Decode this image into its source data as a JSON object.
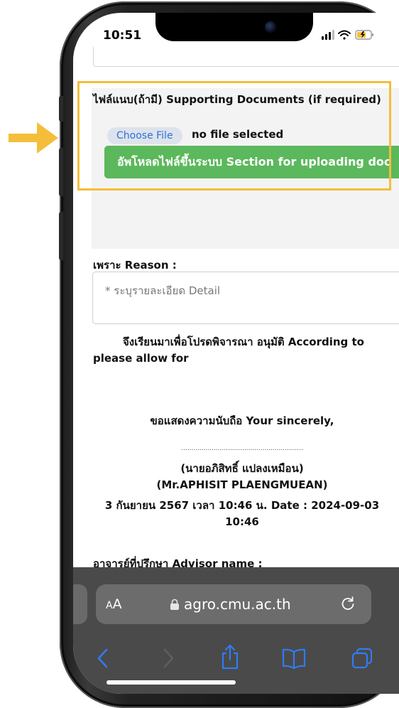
{
  "status_bar": {
    "time": "10:51"
  },
  "form": {
    "attachment_label": "ไฟล์แนบ(ถ้ามี) Supporting Documents (if required)",
    "choose_file_label": "Choose File",
    "no_file_text": "no file selected",
    "upload_button_label": "อัพโหลดไฟล์ขึ้นระบบ Section for uploading doc",
    "reason_label": "เพราะ Reason :",
    "reason_placeholder": "* ระบุรายละเอียด Detail",
    "request_text_line1": "จึงเรียนมาเพื่อโปรดพิจารณา อนุมัติ According to",
    "request_text_line2": "please allow for",
    "sincerely_text": "ขอแสดงความนับถือ Your sincerely,",
    "signature_dots": "............................................................",
    "signer_name_th": "(นายอภิสิทธิ์ แปลงเหมือน)",
    "signer_name_en": "(Mr.APHISIT  PLAENGMUEAN)",
    "signed_date": "3 กันยายน 2567 เวลา 10:46 น. Date : 2024-09-03",
    "signed_time": "10:46",
    "advisor_label": "อาจารย์ที่ปรึกษา Advisor name :"
  },
  "browser": {
    "text_size_label_big": "A",
    "text_size_label_small": "A",
    "url": "agro.cmu.ac.th",
    "icons": {
      "lock": "lock-icon",
      "reload": "reload-icon",
      "back": "back-icon",
      "forward": "forward-icon",
      "share": "share-icon",
      "bookmarks": "bookmarks-icon",
      "tabs": "tabs-icon"
    }
  },
  "colors": {
    "highlight": "#f5be3a",
    "upload_button": "#5cb85c",
    "choose_file_text": "#2f6fd6",
    "toolbar_icon": "#2f7cf6"
  }
}
